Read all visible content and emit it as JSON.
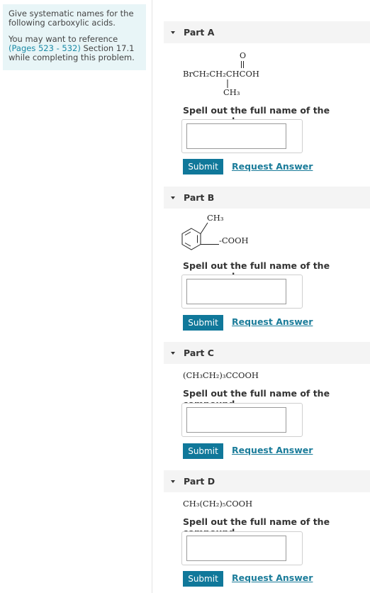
{
  "intro": {
    "line1": "Give systematic names for the following carboxylic acids.",
    "line2_prefix": "You may want to reference",
    "reference_link": "(Pages 523 - 532)",
    "line2_suffix": " Section 17.1 while completing this problem."
  },
  "common": {
    "prompt": "Spell out the full name of the compound.",
    "submit_label": "Submit",
    "request_label": "Request Answer"
  },
  "parts": [
    {
      "label": "Part A",
      "structure": {
        "carbonyl_o": "O",
        "main_chain": "BrCH₂CH₂CHCOH",
        "branch": "CH₃"
      },
      "answer_value": ""
    },
    {
      "label": "Part B",
      "structure": {
        "substituent_top": "CH₃",
        "substituent_side": "-COOH"
      },
      "answer_value": ""
    },
    {
      "label": "Part C",
      "formula": "(CH₃CH₂)₃CCOOH",
      "answer_value": ""
    },
    {
      "label": "Part D",
      "formula": "CH₃(CH₂)₅COOH",
      "answer_value": ""
    }
  ]
}
